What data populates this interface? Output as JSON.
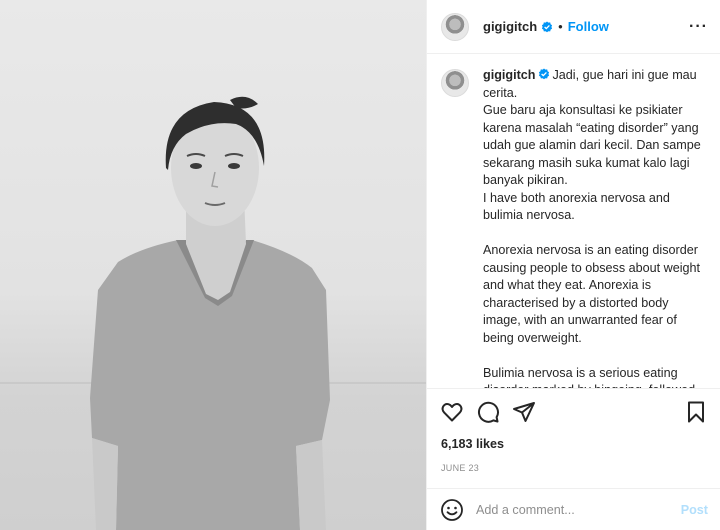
{
  "post": {
    "username": "gigigitch",
    "follow_label": "Follow",
    "dot": "•",
    "more_label": "···"
  },
  "caption": {
    "username": "gigigitch",
    "text": "Jadi, gue hari ini gue mau cerita.\nGue baru aja konsultasi ke psikiater karena masalah “eating disorder” yang udah gue alamin dari kecil. Dan sampe sekarang masih suka kumat kalo lagi banyak pikiran.\nI have both anorexia nervosa and bulimia nervosa.\n\nAnorexia nervosa is an eating disorder causing people to obsess about weight and what they eat. Anorexia is characterised by a distorted body image, with an unwarranted fear of being overweight.\n\nBulimia nervosa is a serious eating disorder marked by bingeing, followed by methods to avoid weight gain."
  },
  "stats": {
    "likes": "6,183 likes",
    "date": "JUNE 23"
  },
  "comment": {
    "placeholder": "Add a comment...",
    "post_label": "Post"
  },
  "icons": {
    "like": "heart-icon",
    "comment": "comment-icon",
    "share": "share-icon",
    "save": "bookmark-icon",
    "emoji": "emoji-icon",
    "verified": "verified-badge-icon"
  },
  "colors": {
    "accent": "#0095f6",
    "post_disabled": "#b2dffc",
    "muted": "#8e8e8e"
  }
}
